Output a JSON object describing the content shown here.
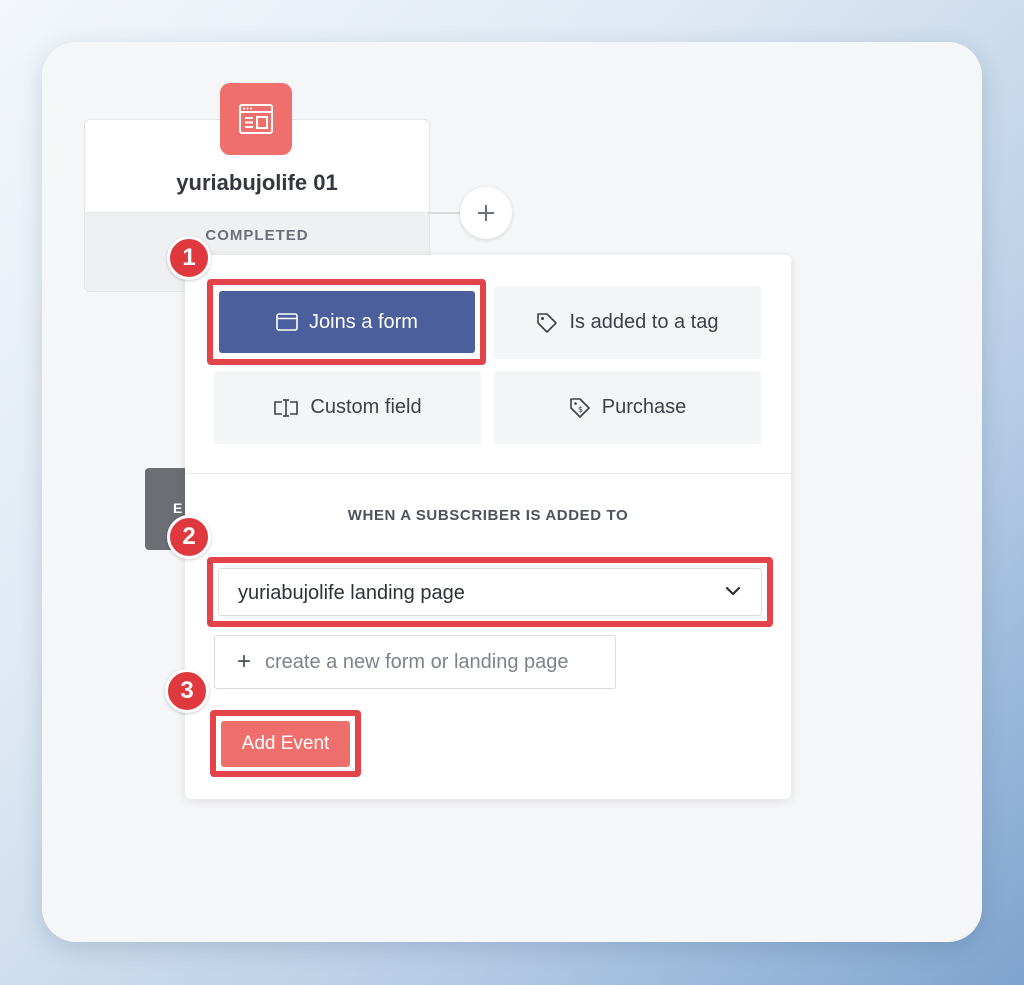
{
  "node": {
    "title": "yuriabujolife 01",
    "status": "COMPLETED",
    "icon": "form-window-icon",
    "icon_color": "#ef6f6c"
  },
  "add_step_icon": "plus-icon",
  "hidden_node": {
    "label": "E"
  },
  "event_panel": {
    "triggers": [
      {
        "label": "Joins a form",
        "icon": "form-window-icon",
        "active": true
      },
      {
        "label": "Is added to a tag",
        "icon": "tag-icon",
        "active": false
      },
      {
        "label": "Custom field",
        "icon": "text-cursor-icon",
        "active": false
      },
      {
        "label": "Purchase",
        "icon": "price-tag-icon",
        "active": false
      }
    ],
    "section_label": "WHEN A SUBSCRIBER IS ADDED TO",
    "selected_form": "yuriabujolife landing page",
    "create_link_icon": "+",
    "create_link": "create a new form or landing page",
    "submit_label": "Add Event"
  },
  "annotations": {
    "steps": [
      "1",
      "2",
      "3"
    ],
    "highlight_color": "#e2444a"
  },
  "colors": {
    "active_trigger": "#4b5f9c",
    "accent": "#ef6f6c"
  }
}
